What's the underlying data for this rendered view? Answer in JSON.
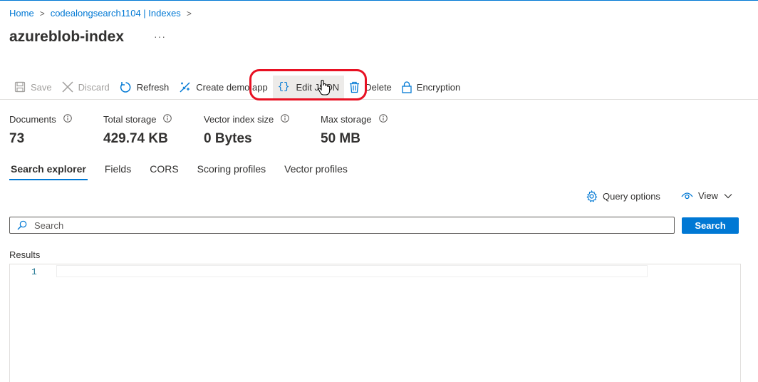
{
  "breadcrumb": {
    "home": "Home",
    "service": "codealongsearch1104 | Indexes"
  },
  "page": {
    "title": "azureblob-index",
    "more": "···"
  },
  "toolbar": {
    "save": "Save",
    "discard": "Discard",
    "refresh": "Refresh",
    "create_demo": "Create demo app",
    "edit_json": "Edit JSON",
    "delete": "Delete",
    "encryption": "Encryption"
  },
  "stats": {
    "documents": {
      "label": "Documents",
      "value": "73"
    },
    "total_storage": {
      "label": "Total storage",
      "value": "429.74 KB"
    },
    "vector_index": {
      "label": "Vector index size",
      "value": "0 Bytes"
    },
    "max_storage": {
      "label": "Max storage",
      "value": "50 MB"
    }
  },
  "tabs": [
    "Search explorer",
    "Fields",
    "CORS",
    "Scoring profiles",
    "Vector profiles"
  ],
  "query": {
    "options": "Query options",
    "view": "View"
  },
  "search": {
    "placeholder": "Search",
    "button": "Search"
  },
  "results": {
    "label": "Results",
    "line_number": "1"
  },
  "colors": {
    "accent": "#0078d4",
    "annotation": "#e81123"
  }
}
